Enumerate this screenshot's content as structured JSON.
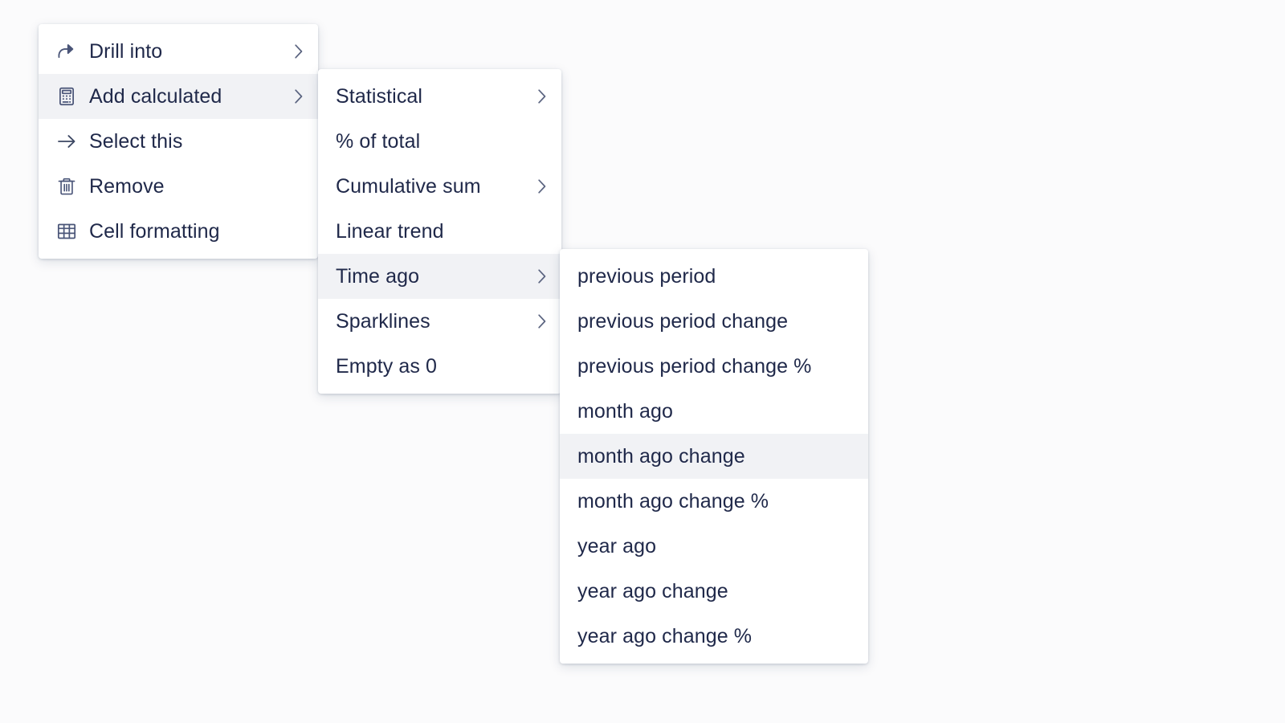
{
  "theme": {
    "text_color": "#20294a",
    "highlight_color": "#f1f2f5",
    "panel_color": "#ffffff",
    "chevron_color": "#5b6480",
    "background_color": "#fbfbfc"
  },
  "context_menu": {
    "name": "cell-context-menu",
    "items": [
      {
        "label": "Drill into",
        "icon": "drill-into-icon",
        "has_submenu": true,
        "highlighted": false
      },
      {
        "label": "Add calculated",
        "icon": "calculator-icon",
        "has_submenu": true,
        "highlighted": true
      },
      {
        "label": "Select this",
        "icon": "arrow-right-icon",
        "has_submenu": false,
        "highlighted": false
      },
      {
        "label": "Remove",
        "icon": "trash-icon",
        "has_submenu": false,
        "highlighted": false
      },
      {
        "label": "Cell formatting",
        "icon": "table-grid-icon",
        "has_submenu": false,
        "highlighted": false
      }
    ]
  },
  "add_calculated_submenu": {
    "name": "add-calculated-submenu",
    "items": [
      {
        "label": "Statistical",
        "has_submenu": true,
        "highlighted": false
      },
      {
        "label": "% of total",
        "has_submenu": false,
        "highlighted": false
      },
      {
        "label": "Cumulative sum",
        "has_submenu": true,
        "highlighted": false
      },
      {
        "label": "Linear trend",
        "has_submenu": false,
        "highlighted": false
      },
      {
        "label": "Time ago",
        "has_submenu": true,
        "highlighted": true
      },
      {
        "label": "Sparklines",
        "has_submenu": true,
        "highlighted": false
      },
      {
        "label": "Empty as 0",
        "has_submenu": false,
        "highlighted": false
      }
    ]
  },
  "time_ago_submenu": {
    "name": "time-ago-submenu",
    "items": [
      {
        "label": "previous period",
        "has_submenu": false,
        "highlighted": false
      },
      {
        "label": "previous period change",
        "has_submenu": false,
        "highlighted": false
      },
      {
        "label": "previous period change %",
        "has_submenu": false,
        "highlighted": false
      },
      {
        "label": "month ago",
        "has_submenu": false,
        "highlighted": false
      },
      {
        "label": "month ago change",
        "has_submenu": false,
        "highlighted": true
      },
      {
        "label": "month ago change %",
        "has_submenu": false,
        "highlighted": false
      },
      {
        "label": "year ago",
        "has_submenu": false,
        "highlighted": false
      },
      {
        "label": "year ago change",
        "has_submenu": false,
        "highlighted": false
      },
      {
        "label": "year ago change %",
        "has_submenu": false,
        "highlighted": false
      }
    ]
  }
}
